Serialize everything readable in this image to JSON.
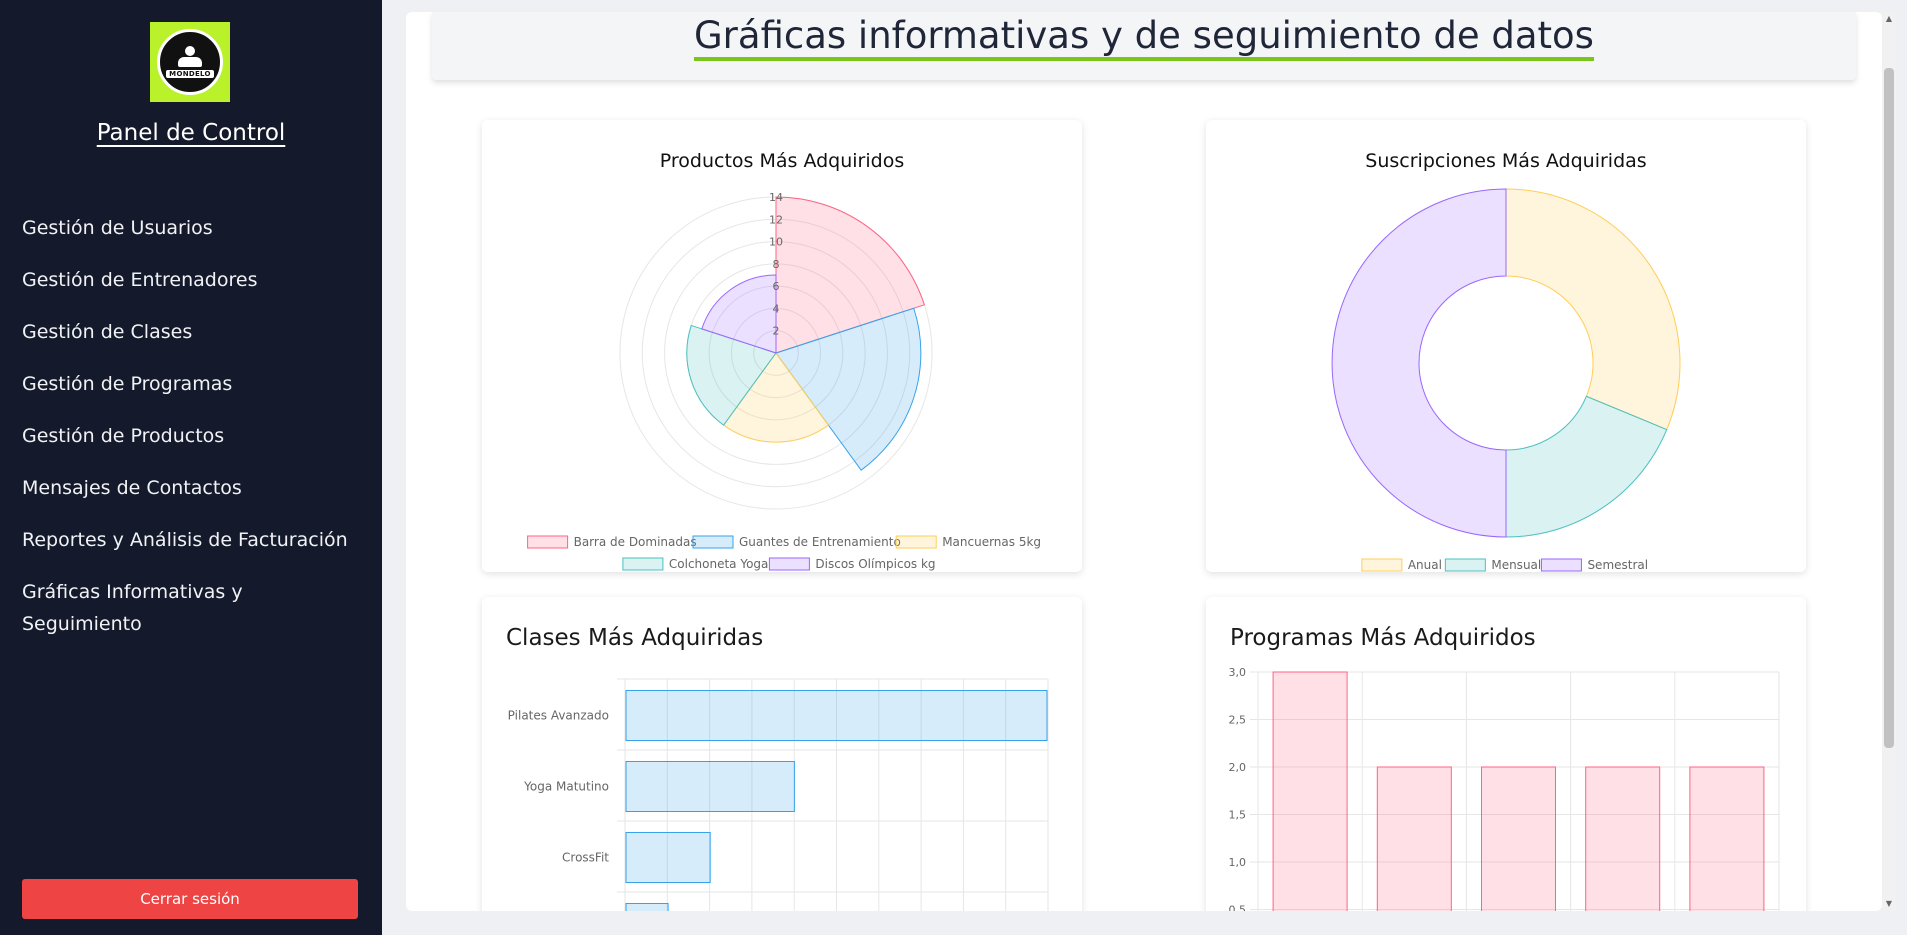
{
  "sidebar": {
    "logo_text": "MONDELO",
    "title": "Panel de Control",
    "items": [
      {
        "label": "Gestión de Usuarios"
      },
      {
        "label": "Gestión de Entrenadores"
      },
      {
        "label": "Gestión de Clases"
      },
      {
        "label": "Gestión de Programas"
      },
      {
        "label": "Gestión de Productos"
      },
      {
        "label": "Mensajes de Contactos"
      },
      {
        "label": "Reportes y Análisis de Facturación"
      },
      {
        "label": "Gráficas Informativas y Seguimiento"
      }
    ],
    "logout_label": "Cerrar sesión"
  },
  "header": {
    "title": "Gráficas informativas y de seguimiento de datos"
  },
  "colors": {
    "sidebar_bg": "#141a2b",
    "accent_green": "#b9f12b",
    "logout_red": "#ef4444"
  },
  "cards": {
    "productos": {
      "title": "Productos Más Adquiridos"
    },
    "suscripciones": {
      "title": "Suscripciones Más Adquiridas"
    },
    "clases": {
      "title": "Clases Más Adquiridas"
    },
    "programas": {
      "title": "Programas Más Adquiridos"
    }
  },
  "chart_data": [
    {
      "type": "polarArea",
      "title": "Productos Más Adquiridos",
      "categories": [
        "Barra de Dominadas",
        "Guantes de Entrenamiento",
        "Mancuernas 5kg",
        "Colchoneta Yoga",
        "Discos Olímpicos kg"
      ],
      "values": [
        14,
        13,
        8,
        8,
        7
      ],
      "rlim": [
        0,
        14
      ],
      "ticks": [
        "2",
        "4",
        "6",
        "8",
        "10",
        "12",
        "14"
      ],
      "colors": [
        "#ff6384",
        "#36a2eb",
        "#ffce56",
        "#4bc0c0",
        "#9966ff"
      ],
      "legend": "bottom"
    },
    {
      "type": "pie",
      "title": "Suscripciones Más Adquiridas",
      "categories": [
        "Anual",
        "Mensual",
        "Semestral"
      ],
      "values": [
        5,
        3,
        8
      ],
      "colors": [
        "#ffce56",
        "#4bc0c0",
        "#9966ff"
      ],
      "legend": "bottom"
    },
    {
      "type": "bar",
      "orientation": "horizontal",
      "title": "Clases Más Adquiridas",
      "categories": [
        "Pilates Avanzado",
        "Yoga Matutino",
        "CrossFit",
        ""
      ],
      "values": [
        10,
        4,
        2,
        1
      ],
      "xlim": [
        0,
        10
      ],
      "grid": true
    },
    {
      "type": "bar",
      "title": "Programas Más Adquiridos",
      "categories": [
        "",
        "",
        "",
        "",
        ""
      ],
      "values": [
        3,
        2,
        2,
        2,
        2
      ],
      "ylim": [
        0,
        3
      ],
      "yticks": [
        "3,0",
        "2,5",
        "2,0",
        "1,5",
        "1,0",
        "0,5"
      ],
      "grid": true
    }
  ]
}
